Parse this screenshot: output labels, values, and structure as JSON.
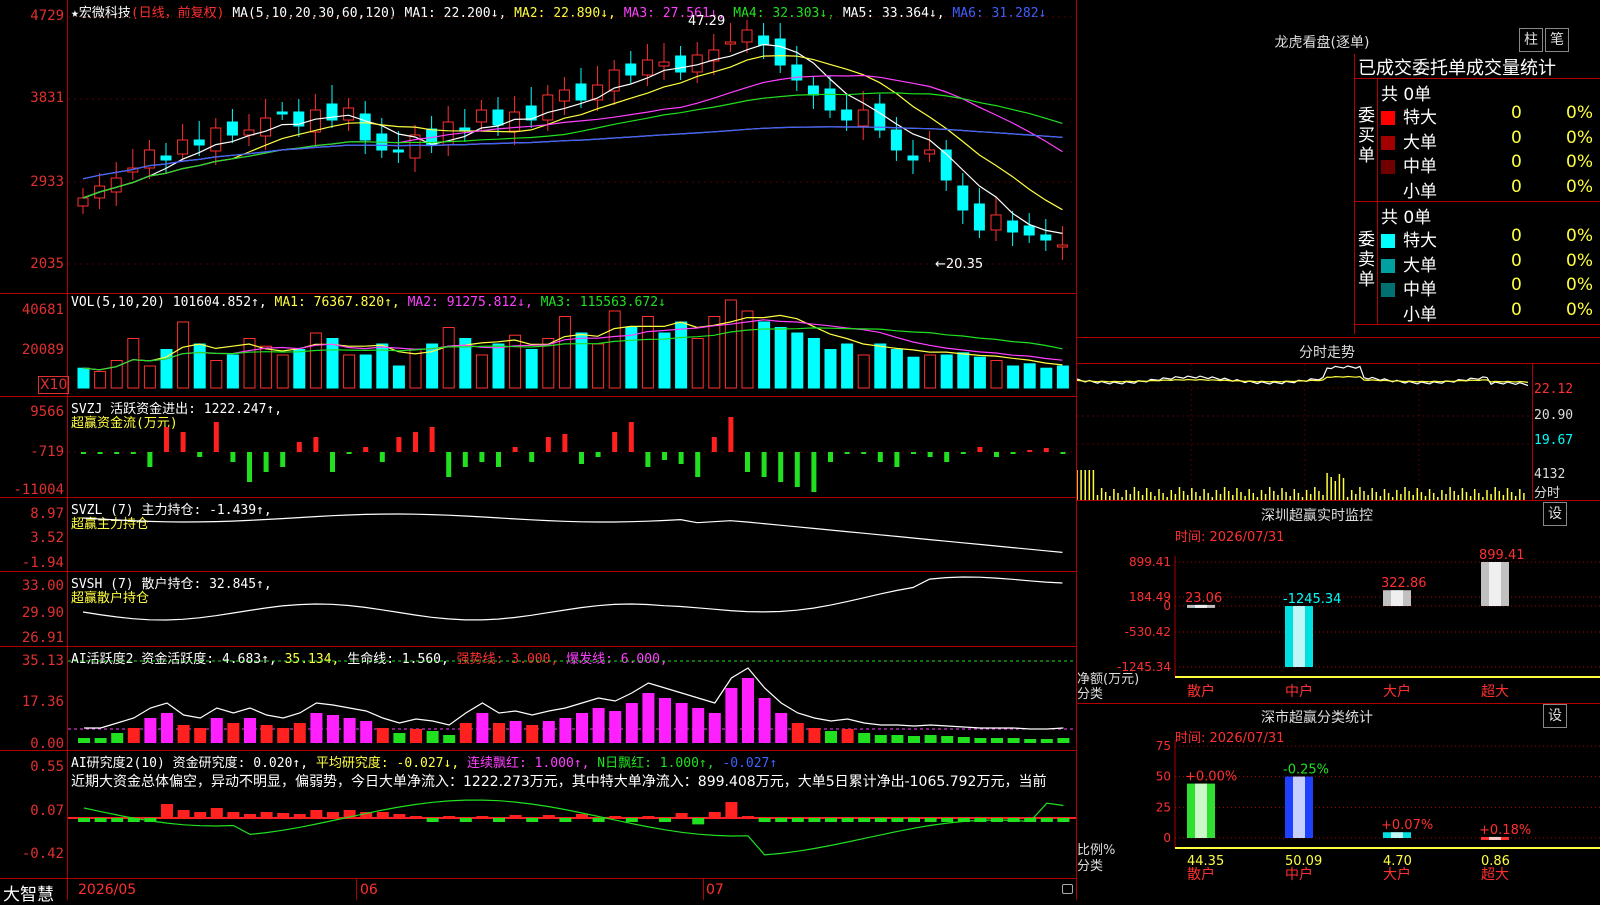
{
  "kline": {
    "header": {
      "star": "★",
      "stock": "宏微科技",
      "period": "(日线，前复权)",
      "ma_def": "MA(5,10,20,30,60,120)",
      "ma1": "MA1: 22.200↓,",
      "ma2": "MA2: 22.890↓,",
      "ma3": "MA3: 27.561↓,",
      "ma4": "MA4: 32.303↓,",
      "ma5": "MA5: 33.364↓,",
      "ma6": "MA6: 31.282↓"
    },
    "y_labels": [
      "4729",
      "3831",
      "2933",
      "2035"
    ],
    "high_note": "47.29",
    "low_note": "←20.35",
    "colors": {
      "up": "#ff3030",
      "down": "#00ffff",
      "ma1": "#ffffff",
      "ma2": "#ffff40",
      "ma3": "#ff40ff",
      "ma4": "#20e020",
      "ma5": "#c0c0c0",
      "ma6": "#4060ff"
    }
  },
  "vol": {
    "def": "VOL(5,10,20)",
    "val": "101604.852↑,",
    "ma1": "MA1: 76367.820↑,",
    "ma2": "MA2: 91275.812↓,",
    "ma3": "MA3: 115563.672↓",
    "y_labels": [
      "40681",
      "20089"
    ],
    "unit": "X10"
  },
  "svzj": {
    "line1": "SVZJ  活跃资金进出: 1222.247↑,",
    "line2": "超赢资金流(万元)",
    "y_labels": [
      "9566",
      "-719",
      "-11004"
    ]
  },
  "svzl": {
    "line1": "SVZL (7) 主力持仓: -1.439↑,",
    "line2": "超赢主力持仓",
    "y_labels": [
      "8.97",
      "3.52",
      "-1.94"
    ]
  },
  "svsh": {
    "line1": "SVSH (7) 散户持仓: 32.845↑,",
    "line2": "超赢散户持仓",
    "y_labels": [
      "33.00",
      "29.90",
      "26.91"
    ]
  },
  "ai_active": {
    "title": "AI活跃度2 资金活跃度: 4.683↑,",
    "v2": "35.134,",
    "life": "生命线: 1.560,",
    "strong": "强势线: 3.000,",
    "burst": "爆发线: 6.000,",
    "y_labels": [
      "35.13",
      "17.36",
      "0.00"
    ]
  },
  "ai_research": {
    "title": "AI研究度2(10) 资金研究度: 0.020↑,",
    "avg": "平均研究度: -0.027↓,",
    "cont": "连续飘红: 1.000↑,",
    "nday": "N日飘红: 1.000↑,",
    "last": "-0.027↑",
    "text": "近期大资金总体偏空，异动不明显，偏弱势，今日大单净流入：1222.273万元，其中特大单净流入：899.408万元，大单5日累计净出-1065.792万元，当前",
    "y_labels": [
      "0.55",
      "0.07",
      "-0.42"
    ]
  },
  "bottom": {
    "brand": "大智慧",
    "dates": [
      "2026/05",
      "06",
      "07"
    ]
  },
  "right": {
    "dragon_title": "龙虎看盘(逐单)",
    "btn_zhu": "柱",
    "btn_bi": "笔",
    "table_title": "已成交委托单成交量统计",
    "buy_label": "委买单",
    "sell_label": "委卖单",
    "buy_total": "共 0单",
    "sell_total": "共 0单",
    "rows": [
      {
        "name": "特大",
        "count": "0",
        "pct": "0%"
      },
      {
        "name": "大单",
        "count": "0",
        "pct": "0%"
      },
      {
        "name": "中单",
        "count": "0",
        "pct": "0%"
      },
      {
        "name": "小单",
        "count": "0",
        "pct": "0%"
      }
    ],
    "buy_colors": [
      "#ff0000",
      "#a00000",
      "#700000",
      "#000000"
    ],
    "sell_colors": [
      "#00ffff",
      "#00a0a0",
      "#007070",
      "#000000"
    ],
    "intraday_title": "分时走势",
    "intraday_labels": [
      "22.12",
      "20.90",
      "19.67",
      "4132",
      "分时"
    ],
    "sz_title": "深圳超赢实时监控",
    "sz_time": "时间: 2026/07/31",
    "sz_set": "设",
    "sz_y": [
      "899.41",
      "184.49",
      "0",
      "-530.42",
      "-1245.34"
    ],
    "sz_unit": "净额(万元)",
    "sz_cat": "分类",
    "classify_title": "深市超赢分类统计",
    "cl_time": "时间: 2026/07/31",
    "cl_set": "设",
    "cl_y": [
      "75",
      "50",
      "25",
      "0"
    ],
    "cl_unit": "比例%",
    "cl_cat": "分类"
  },
  "chart_data": [
    {
      "type": "bar",
      "title": "深圳超赢实时监控",
      "categories": [
        "散户",
        "中户",
        "大户",
        "超大"
      ],
      "values": [
        23.06,
        -1245.34,
        322.86,
        899.41
      ],
      "ylabel": "净额(万元)",
      "ylim": [
        -1245.34,
        899.41
      ]
    },
    {
      "type": "bar",
      "title": "深市超赢分类统计",
      "categories": [
        "散户",
        "中户",
        "大户",
        "超大"
      ],
      "values": [
        44.35,
        50.09,
        4.7,
        0.86
      ],
      "changes": [
        "+0.00%",
        "-0.25%",
        "+0.07%",
        "+0.18%"
      ],
      "ylabel": "比例%",
      "ylim": [
        0,
        75
      ]
    }
  ]
}
